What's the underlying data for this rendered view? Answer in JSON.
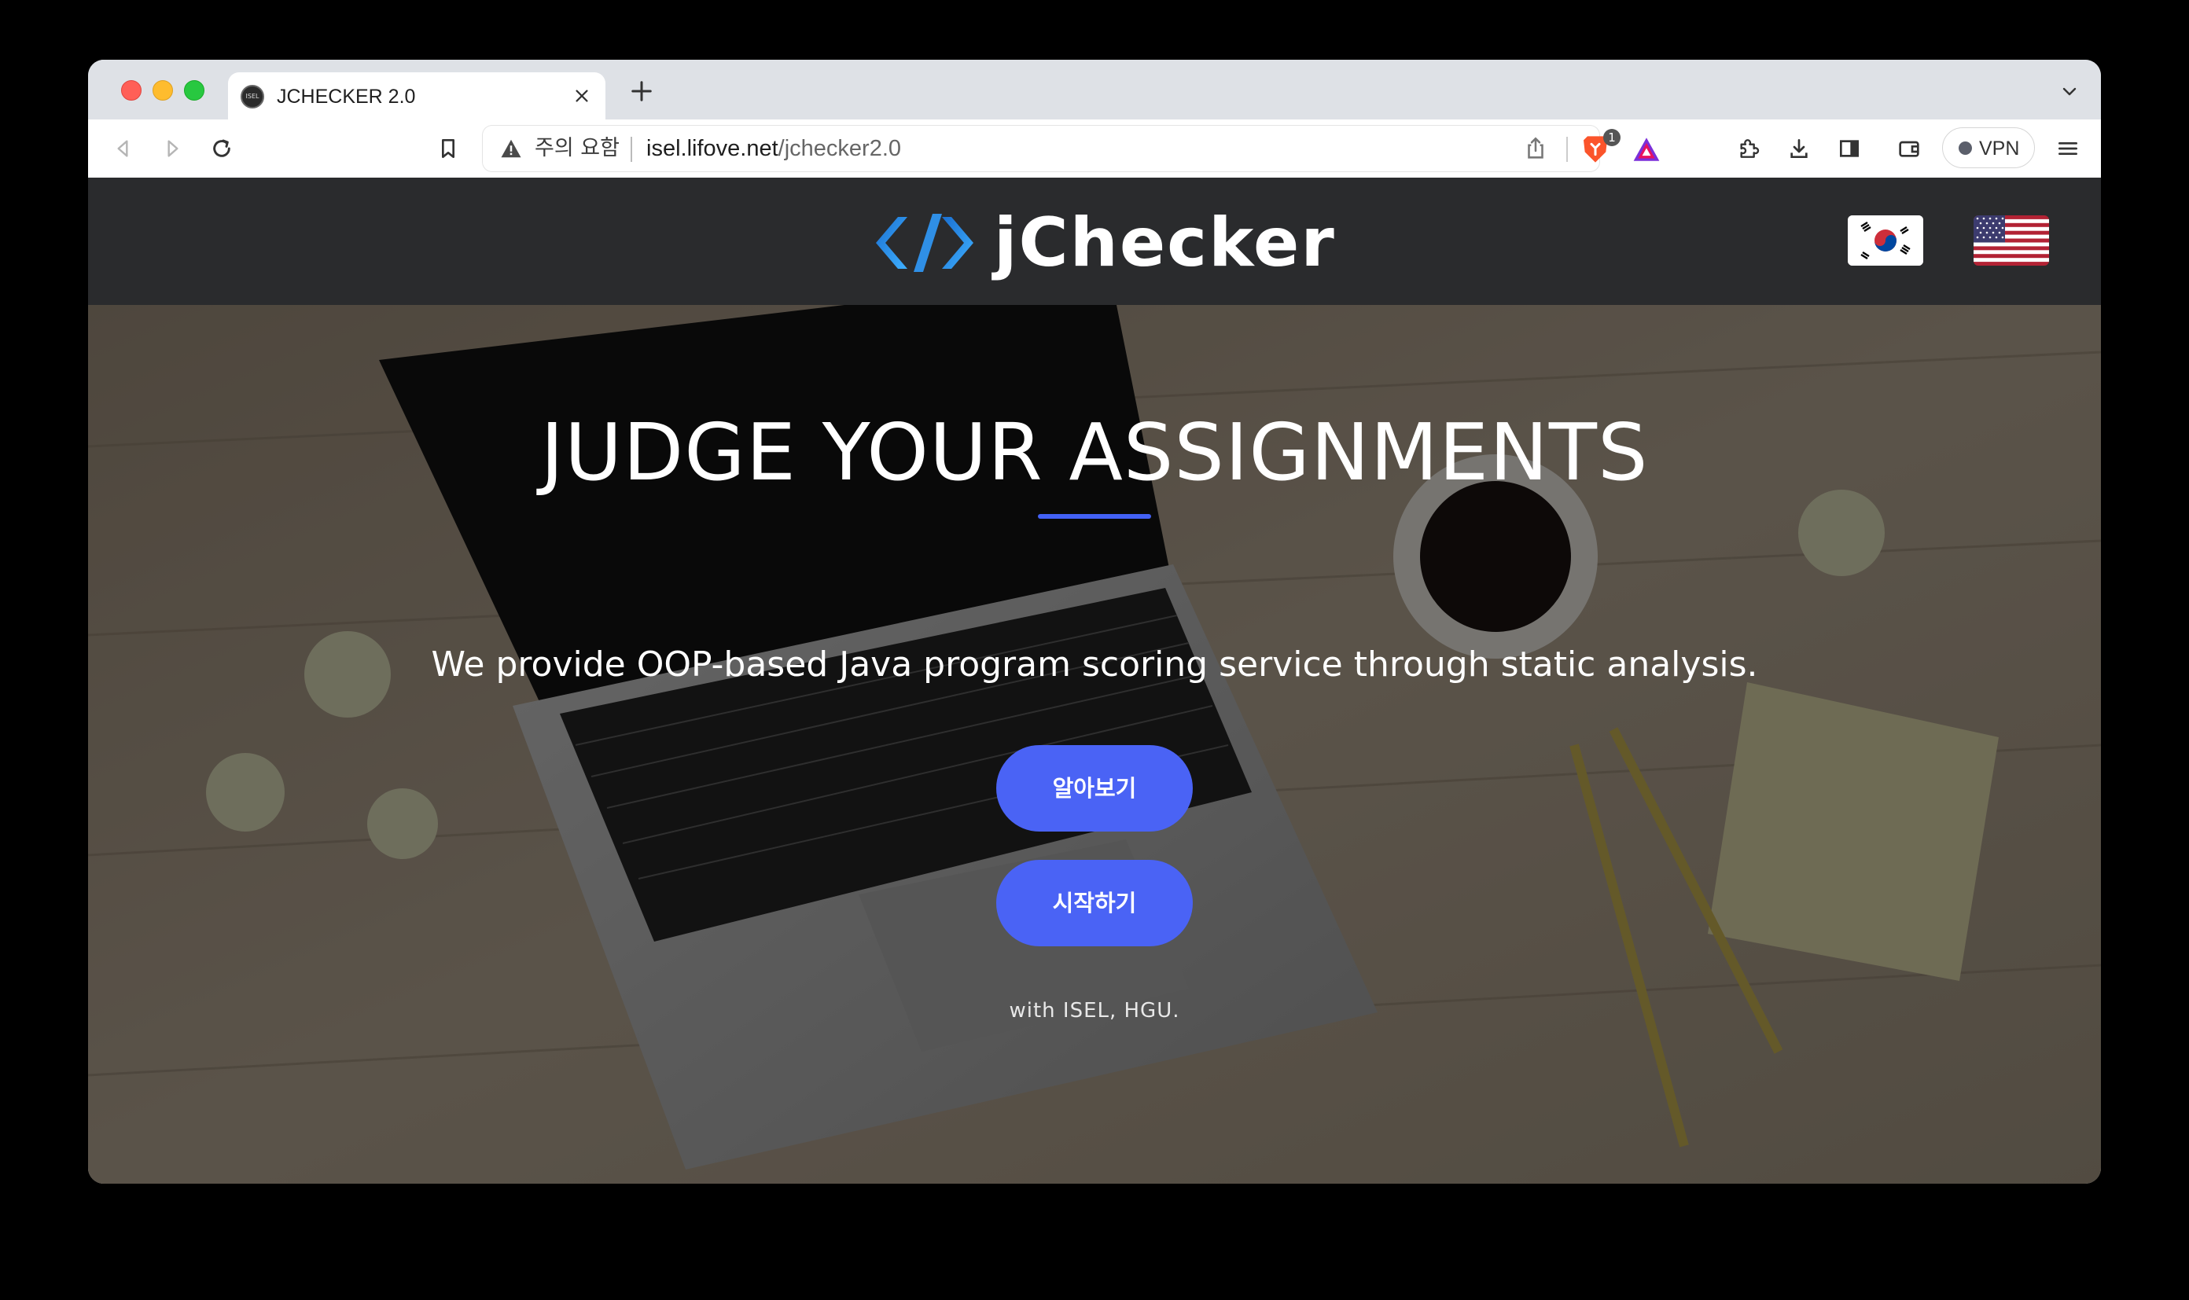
{
  "browser": {
    "tab": {
      "title": "JCHECKER 2.0",
      "favicon_text": "ISEL"
    },
    "url_warning": "주의 요함",
    "url_host": "isel.lifove.net",
    "url_path": "/jchecker2.0",
    "shields_count": "1",
    "vpn_label": "VPN",
    "icons": {
      "back": "back-arrow-icon",
      "forward": "forward-arrow-icon",
      "reload": "reload-icon",
      "bookmark": "bookmark-icon",
      "share": "share-icon",
      "extensions": "puzzle-icon",
      "downloads": "download-icon",
      "sidebar": "sidebar-icon",
      "wallet": "wallet-icon",
      "menu": "hamburger-menu-icon"
    }
  },
  "site": {
    "logo_text": "jChecker",
    "languages": [
      "ko",
      "en"
    ]
  },
  "hero": {
    "title": "JUDGE YOUR ASSIGNMENTS",
    "subtitle": "We provide OOP-based Java program scoring service through static analysis.",
    "primary_button": "알아보기",
    "secondary_button": "시작하기",
    "credit": "with ISEL, HGU."
  },
  "colors": {
    "accent": "#4a63f5",
    "header_bg": "#2a2b2d",
    "logo_blue": "#2f8fe6"
  }
}
